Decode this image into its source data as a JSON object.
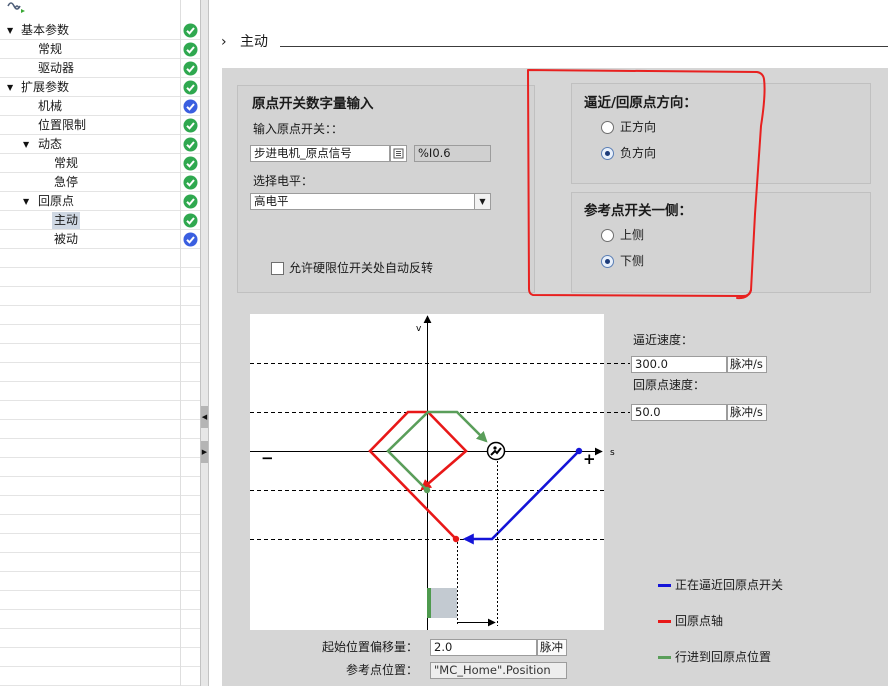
{
  "tree": {
    "items": [
      {
        "toggle": "▼",
        "label": "基本参数",
        "status_icon": "check-green-icon"
      },
      {
        "label": "常规",
        "status_icon": "check-green-icon"
      },
      {
        "label": "驱动器",
        "status_icon": "check-green-icon"
      },
      {
        "toggle": "▼",
        "label": "扩展参数",
        "status_icon": "check-green-icon"
      },
      {
        "label": "机械",
        "status_icon": "check-blue-icon"
      },
      {
        "label": "位置限制",
        "status_icon": "check-green-icon"
      },
      {
        "toggle": "▼",
        "label": "动态",
        "status_icon": "check-green-icon"
      },
      {
        "label": "常规",
        "status_icon": "check-green-icon"
      },
      {
        "label": "急停",
        "status_icon": "check-green-icon"
      },
      {
        "toggle": "▼",
        "label": "回原点",
        "status_icon": "check-green-icon"
      },
      {
        "label": "主动",
        "status_icon": "check-green-icon",
        "selected": true
      },
      {
        "label": "被动",
        "status_icon": "check-blue-icon"
      }
    ]
  },
  "splitter": {
    "collapse_glyph": "◀",
    "expand_glyph": "▶"
  },
  "header": {
    "chevron": "›",
    "title": "主动"
  },
  "home_switch_input": {
    "title": "原点开关数字量输入",
    "input_label": "输入原点开关：：",
    "input_value": "步进电机_原点信号",
    "address": "%I0.6",
    "level_label": "选择电平：",
    "level_value": "高电平",
    "auto_reverse_label": "允许硬限位开关处自动反转",
    "auto_reverse_checked": false
  },
  "direction": {
    "title": "逼近/回原点方向：",
    "options": [
      {
        "label": "正方向",
        "checked": false
      },
      {
        "label": "负方向",
        "checked": true
      }
    ]
  },
  "switch_side": {
    "title": "参考点开关一侧：",
    "options": [
      {
        "label": "上侧",
        "checked": false
      },
      {
        "label": "下侧",
        "checked": true
      }
    ]
  },
  "diagram": {
    "v_axis": "v",
    "s_axis": "s",
    "minus": "−",
    "plus": "+"
  },
  "speeds": {
    "approach_label": "逼近速度：",
    "approach_value": "300.0",
    "approach_unit": "脉冲/s",
    "homing_label": "回原点速度：",
    "homing_value": "50.0",
    "homing_unit": "脉冲/s"
  },
  "legend": [
    {
      "label": "正在逼近回原点开关",
      "color": "#1414d8"
    },
    {
      "label": "回原点轴",
      "color": "#e81818"
    },
    {
      "label": "行进到回原点位置",
      "color": "#5a9e5a"
    }
  ],
  "offset": {
    "label": "起始位置偏移量：",
    "value": "2.0",
    "unit": "脉冲"
  },
  "reference": {
    "label": "参考点位置：",
    "value": "\"MC_Home\".Position"
  },
  "colors": {
    "status_green": "#2fa84f",
    "status_blue": "#3a5fe0",
    "annotation_red": "#e8201f",
    "panel_gray": "#d6d6d6"
  }
}
